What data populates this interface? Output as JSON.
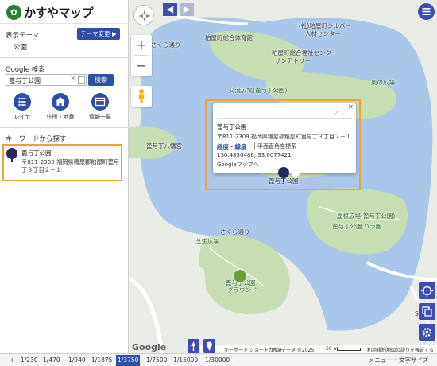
{
  "header": {
    "app_title": "かすやマップ"
  },
  "theme": {
    "label": "表示テーマ",
    "value": "公園",
    "change_button": "テーマ変更 ▶"
  },
  "search": {
    "label": "Google 検索",
    "value": "篦与丁公園",
    "clear": "×",
    "button": "検索"
  },
  "tools": [
    {
      "label": "レイヤ",
      "icon": "layer-list-icon"
    },
    {
      "label": "住所・地番",
      "icon": "home-icon"
    },
    {
      "label": "情報一覧",
      "icon": "table-icon"
    }
  ],
  "keyword_label": "キーワードから探す",
  "result": {
    "name": "篦与丁公園",
    "address": "〒811-2309 福岡県糟屋郡粕屋町篦与丁３丁目２－１"
  },
  "sidebar_toggle": "«",
  "nav": {
    "back": "◀",
    "forward": "▶"
  },
  "zoom": {
    "in": "+",
    "out": "−"
  },
  "popup": {
    "close": "×",
    "name": "篦与丁公園",
    "address": "〒811-2309 福岡県糟屋郡粕屋町篦与丁３丁目２－１",
    "coord_type": "経度・緯度",
    "coord_system": "平面直角座標系",
    "coords": "130.4850486, 33.6077421",
    "google_link": "Googleマップへ"
  },
  "map_labels": [
    {
      "text": "さくら通り",
      "cls": ""
    },
    {
      "text": "粕屋町総合体育館",
      "cls": ""
    },
    {
      "text": "(社)粕屋町シルバー",
      "cls": ""
    },
    {
      "text": "人材センター",
      "cls": ""
    },
    {
      "text": "粕屋町総合福祉センター",
      "cls": ""
    },
    {
      "text": "サンアトリー",
      "cls": ""
    },
    {
      "text": "交流広場(篦与丁公園)",
      "cls": "green"
    },
    {
      "text": "風の広場",
      "cls": "green"
    },
    {
      "text": "篦与丁八幡宮",
      "cls": ""
    },
    {
      "text": "篦与丁公園",
      "cls": ""
    },
    {
      "text": "屋根広場(篦与丁公園)",
      "cls": "green"
    },
    {
      "text": "篦与丁公園 バラ園",
      "cls": "green"
    },
    {
      "text": "芝生広場",
      "cls": "green"
    },
    {
      "text": "さくら通り",
      "cls": ""
    },
    {
      "text": "篦与丁公園",
      "cls": "green"
    },
    {
      "text": "グラウンド",
      "cls": "green"
    },
    {
      "text": "Spro",
      "cls": ""
    }
  ],
  "map_footer": {
    "google": "Google",
    "shortcuts": "キーボード ショートカット",
    "credit": "地図データ ©2025",
    "scale": "50 m",
    "terms": "利用規約",
    "report": "地図の誤りを報告する"
  },
  "scales": [
    "1/230",
    "1/470",
    "1/940",
    "1/1875",
    "1/3750",
    "1/7500",
    "1/15000",
    "1/30000"
  ],
  "active_scale": "1/3750",
  "bottom": {
    "plus": "+",
    "minus": "-",
    "menu": "メニュー ·",
    "text_size": "文字サイズ"
  },
  "colors": {
    "accent": "#2f4ea8",
    "highlight": "#f2a033",
    "water": "#aac6e8",
    "park": "#c7ddb4",
    "pin": "#232c57"
  }
}
